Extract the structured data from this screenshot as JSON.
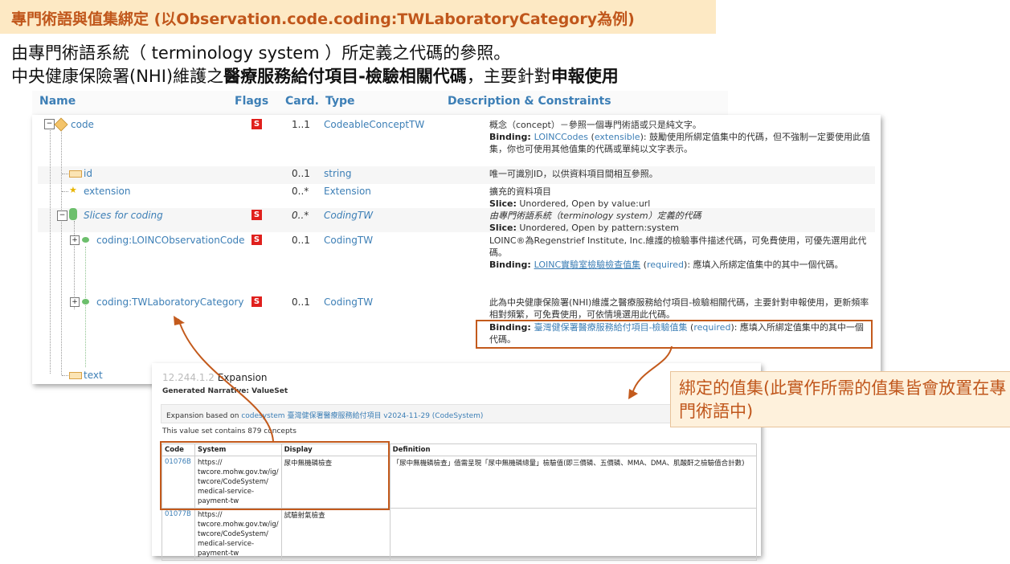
{
  "banner": "專門術語與值集綁定 (以Observation.code.coding:TWLaboratoryCategory為例)",
  "intro_line1": "由專門術語系統（ terminology system ）所定義之代碼的參照。",
  "intro_line2_plain": "中央健康保險署(NHI)維護之",
  "intro_line2_bold1": "醫療服務給付項目-檢驗相關代碼",
  "intro_line2_mid": "，主要針對",
  "intro_line2_bold2": "申報使用",
  "table": {
    "headers": {
      "name": "Name",
      "flags": "Flags",
      "card": "Card.",
      "type": "Type",
      "desc": "Description & Constraints"
    },
    "rows": {
      "code": {
        "name": "code",
        "flag": "S",
        "card": "1..1",
        "type": "CodeableConceptTW",
        "desc1": "概念（concept）－參照一個專門術語或只是純文字。",
        "desc2_label": "Binding: ",
        "desc2_link": "LOINCCodes",
        "desc2_strength": "extensible",
        "desc2_rest": "): 鼓勵使用所綁定值集中的代碼，但不強制一定要使用此值集，你也可使用其他值集的代碼或單純以文字表示。"
      },
      "id": {
        "name": "id",
        "card": "0..1",
        "type": "string",
        "desc": "唯一可識別ID，以供資料項目間相互參照。"
      },
      "extension": {
        "name": "extension",
        "card": "0..*",
        "type": "Extension",
        "desc1": "擴充的資料項目",
        "desc2_label": "Slice:",
        "desc2_rest": " Unordered, Open by value:url"
      },
      "slices": {
        "name": "Slices for coding",
        "flag": "S",
        "card": "0..*",
        "type": "CodingTW",
        "desc1": "由專門術語系統（terminology system）定義的代碼",
        "desc2_label": "Slice:",
        "desc2_rest": " Unordered, Open by pattern:system"
      },
      "loinc": {
        "name": "coding:LOINCObservationCode",
        "flag": "S",
        "card": "0..1",
        "type": "CodingTW",
        "desc1": "LOINC®為Regenstrief Institute, Inc.維護的檢驗事件描述代碼，可免費使用，可優先選用此代碼。",
        "desc2_label": "Binding: ",
        "desc2_link": "LOINC實驗室檢驗檢查值集",
        "desc2_strength": "required",
        "desc2_rest": "): 應填入所綁定值集中的其中一個代碼。"
      },
      "twlab": {
        "name": "coding:TWLaboratoryCategory",
        "flag": "S",
        "card": "0..1",
        "type": "CodingTW",
        "desc1": "此為中央健康保險署(NHI)維護之醫療服務給付項目-檢驗相關代碼，主要針對申報使用，更新頻率相對頻繁，可免費使用，可依情境選用此代碼。",
        "desc2_label": "Binding: ",
        "desc2_link": "臺灣健保署醫療服務給付項目-檢驗值集",
        "desc2_strength": "required",
        "desc2_rest": "): 應填入所綁定值集中的其中一個代碼。"
      },
      "text": {
        "name": "text"
      }
    }
  },
  "valueset": {
    "oid": "12.244.1.2",
    "title": "Expansion",
    "narrative": "Generated Narrative: ValueSet",
    "expansion_prefix": "Expansion based on ",
    "expansion_link1": "codesystem",
    "expansion_link2": "臺灣健保署醫療服務給付項目 v2024-11-29 (CodeSystem)",
    "count_text": "This value set contains 879 concepts",
    "columns": [
      "Code",
      "System",
      "Display",
      "Definition"
    ],
    "rows": [
      {
        "code": "01076B",
        "system": "https://\ntwcore.mohw.gov.tw/ig/\ntwcore/CodeSystem/\nmedical-service-\npayment-tw",
        "display": "尿中無機磷檢查",
        "definition": "「尿中無機磷檢查」值需呈現「尿中無機磷總量」檢驗值(即三價磷、五價磷、MMA、DMA、肌酸酐之檢驗值合計數)"
      },
      {
        "code": "01077B",
        "system": "https://\ntwcore.mohw.gov.tw/ig/\ntwcore/CodeSystem/\nmedical-service-\npayment-tw",
        "display": "試驗射氣檢查",
        "definition": ""
      }
    ]
  },
  "callout": "綁定的值集(此實作所需的值集皆會放置在專門術語中)",
  "colors": {
    "accent": "#c0561b",
    "link": "#3d7fb6",
    "flag": "#e0201d"
  },
  "icons": {
    "code": "cube-icon",
    "id": "primitive-icon",
    "extension": "star-icon",
    "slices": "slice-icon",
    "coding": "datatype-icon"
  }
}
